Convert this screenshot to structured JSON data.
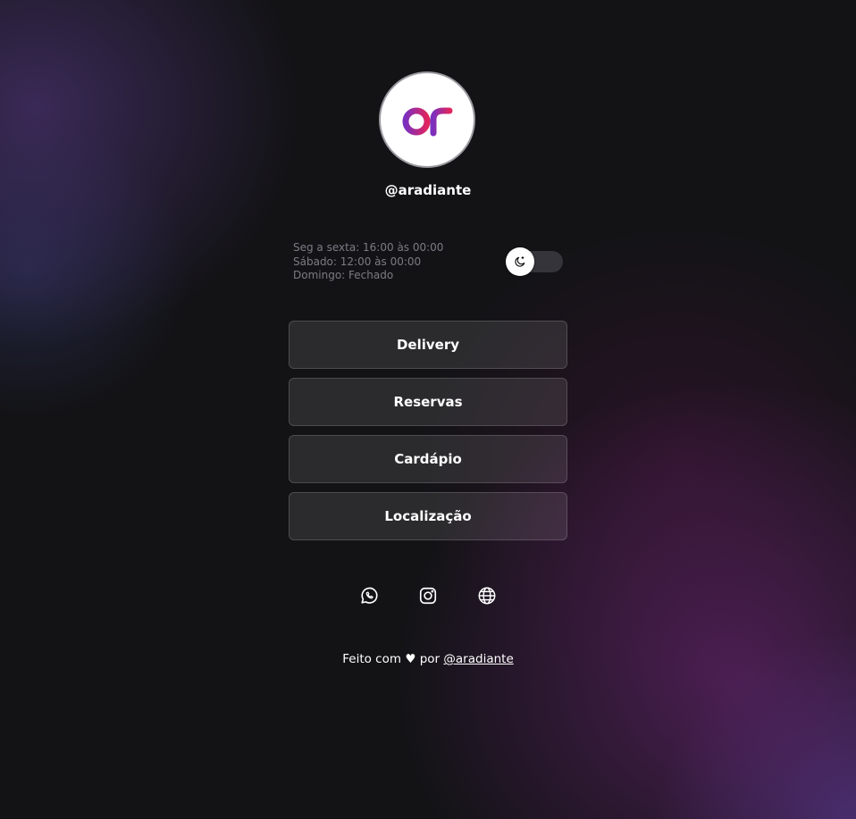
{
  "profile": {
    "handle": "@aradiante",
    "logo_text": "ar",
    "logo_colors": [
      "#7b2fbf",
      "#e0245e"
    ]
  },
  "hours": [
    "Seg a sexta: 16:00 às 00:00",
    "Sábado: 12:00 às 00:00",
    "Domingo: Fechado"
  ],
  "theme_toggle": {
    "icon": "moon-icon",
    "state": "dark"
  },
  "links": [
    {
      "label": "Delivery"
    },
    {
      "label": "Reservas"
    },
    {
      "label": "Cardápio"
    },
    {
      "label": "Localização"
    }
  ],
  "social": [
    {
      "icon": "whatsapp-icon"
    },
    {
      "icon": "instagram-icon"
    },
    {
      "icon": "globe-icon"
    }
  ],
  "footer": {
    "prefix": "Feito com",
    "heart": "♥",
    "by": "por",
    "link": "@aradiante"
  }
}
